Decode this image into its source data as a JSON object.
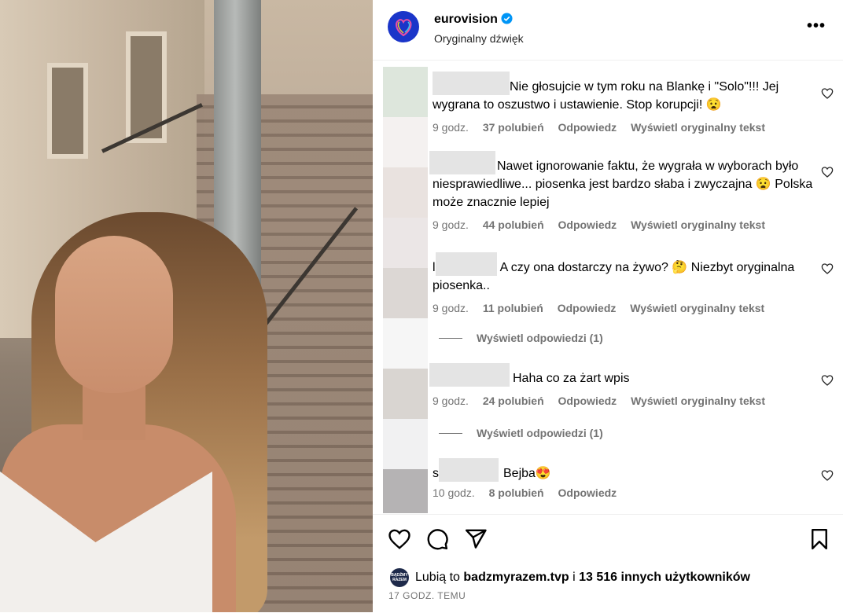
{
  "post": {
    "username": "eurovision",
    "subtitle": "Oryginalny dźwięk",
    "more_icon": "more-horizontal-icon"
  },
  "comments": [
    {
      "text": "Nie głosujcie w tym roku na Blankę i \"Solo\"!!! Jej wygrana to oszustwo i ustawienie. Stop korupcji! 😧",
      "time": "9 godz.",
      "likes": "37 polubień",
      "reply": "Odpowiedz",
      "translate": "Wyświetl oryginalny tekst"
    },
    {
      "text": "Nawet ignorowanie faktu, że wygrała w wyborach było niesprawiedliwe... piosenka jest bardzo słaba i zwyczajna 😧 Polska może znacznie lepiej",
      "time": "9 godz.",
      "likes": "44 polubień",
      "reply": "Odpowiedz",
      "translate": "Wyświetl oryginalny tekst"
    },
    {
      "prefix": "l",
      "text": "A czy ona dostarczy na żywo? 🤔 Niezbyt oryginalna piosenka..",
      "time": "9 godz.",
      "likes": "11 polubień",
      "reply": "Odpowiedz",
      "translate": "Wyświetl oryginalny tekst",
      "view_replies": "Wyświetl odpowiedzi (1)"
    },
    {
      "text": "Haha co za żart wpis",
      "time": "9 godz.",
      "likes": "24 polubień",
      "reply": "Odpowiedz",
      "translate": "Wyświetl oryginalny tekst",
      "view_replies": "Wyświetl odpowiedzi (1)"
    },
    {
      "prefix": "s",
      "text": "Bejba😍",
      "time": "10 godz.",
      "likes": "8 polubień",
      "reply": "Odpowiedz"
    }
  ],
  "footer": {
    "liked_prefix": "Lubią to",
    "liked_user": "badzmyrazem.tvp",
    "liked_and": "i",
    "liked_others": "13 516 innych użytkowników",
    "mini_avatar_text": "BĄDŹMY RAZEM",
    "time_ago": "17 GODZ. TEMU"
  },
  "icons": {
    "like": "heart-icon",
    "comment": "comment-icon",
    "share": "share-icon",
    "save": "bookmark-icon"
  }
}
